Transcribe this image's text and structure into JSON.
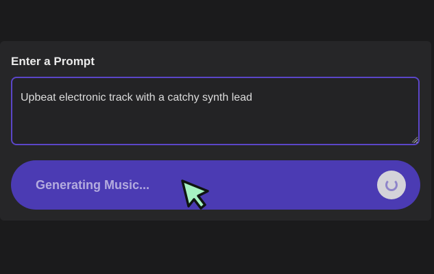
{
  "prompt": {
    "label": "Enter a Prompt",
    "value": "Upbeat electronic track with a catchy synth lead"
  },
  "generate": {
    "label": "Generating Music...",
    "status": "loading"
  },
  "icons": {
    "spinner": "loading-spinner-icon",
    "cursor": "arrow-cursor-icon",
    "grip": "resize-grip-icon"
  },
  "colors": {
    "background": "#1b1b1c",
    "panel": "#262628",
    "accent": "#4b3bb3",
    "field_border": "#5b46c9",
    "cursor": "#a6f3c2"
  }
}
